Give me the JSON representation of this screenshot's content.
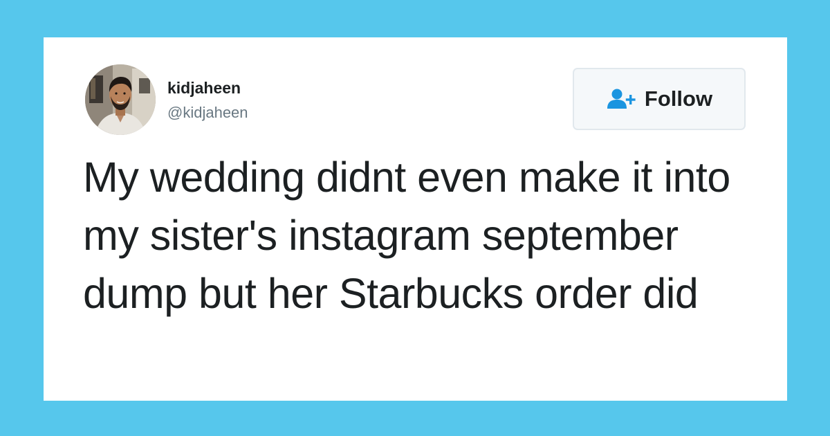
{
  "colors": {
    "page_background": "#56c7ec",
    "card_background": "#ffffff",
    "text_primary": "#1c2022",
    "text_secondary": "#697882",
    "follow_icon": "#1b95e0",
    "button_border": "#e1e8ed",
    "button_background": "#f5f8fa"
  },
  "tweet": {
    "author": {
      "display_name": "kidjaheen",
      "handle": "@kidjaheen",
      "avatar_icon": "profile-photo"
    },
    "follow_button": {
      "label": "Follow",
      "icon": "add-user-icon"
    },
    "text": "My wedding didnt even make it into my sister's instagram september dump but her Starbucks order did"
  }
}
